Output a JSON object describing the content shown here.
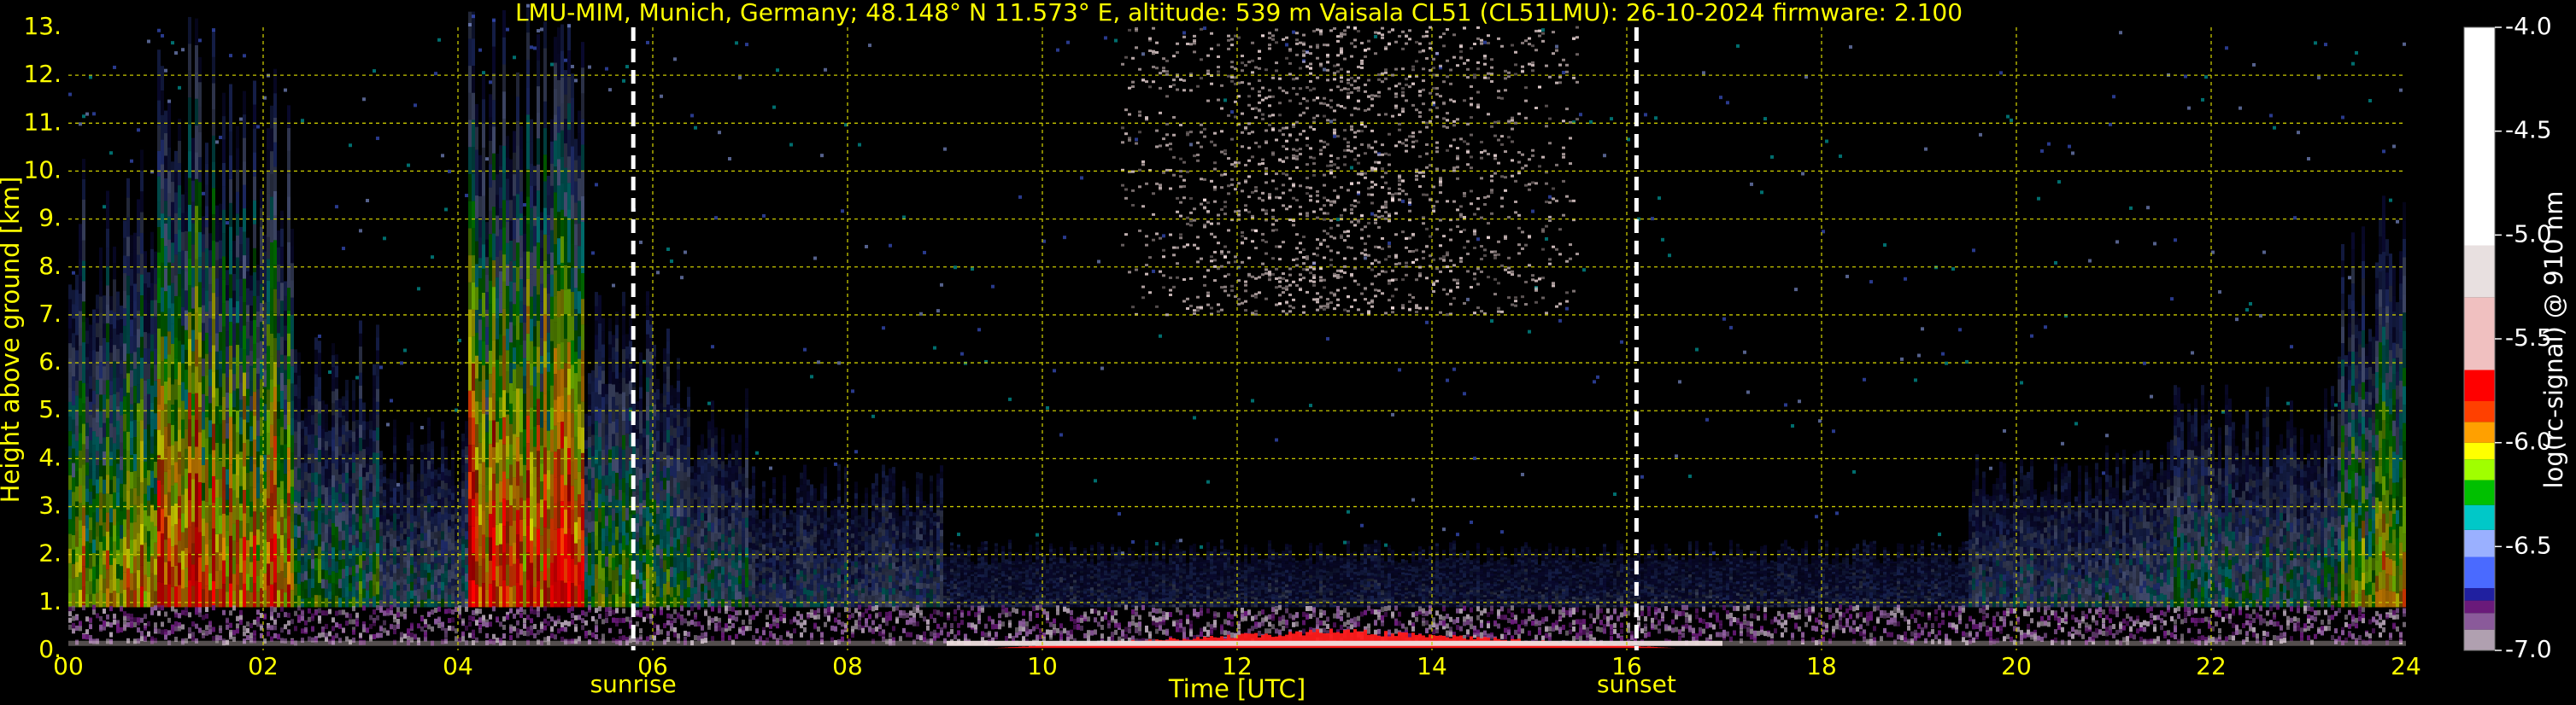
{
  "chart_data": {
    "type": "heatmap",
    "title": "LMU-MIM, Munich, Germany; 48.148° N 11.573° E, altitude: 539 m    Vaisala CL51 (CL51LMU): 26-10-2024    firmware: 2.100",
    "xlabel": "Time [UTC]",
    "ylabel": "Height above ground [km]",
    "xlim": [
      0,
      24
    ],
    "ylim": [
      0,
      13
    ],
    "x_ticks": [
      "00",
      "02",
      "04",
      "06",
      "08",
      "10",
      "12",
      "14",
      "16",
      "18",
      "20",
      "22",
      "24"
    ],
    "y_ticks": [
      "0.",
      "1.",
      "2.",
      "3.",
      "4.",
      "5.",
      "6.",
      "7.",
      "8.",
      "9.",
      "10.",
      "11.",
      "12.",
      "13."
    ],
    "grid": true,
    "annotations": [
      {
        "label": "sunrise",
        "x": 5.8
      },
      {
        "label": "sunset",
        "x": 16.1
      }
    ],
    "colorbar": {
      "label": "log(rc-signal) @ 910 nm",
      "range": [
        -7.0,
        -4.0
      ],
      "ticks": [
        "-4.0",
        "-4.5",
        "-5.0",
        "-5.5",
        "-6.0",
        "-6.5",
        "-7.0"
      ]
    },
    "aerosol_layer": [
      {
        "t_start": 0.0,
        "t_end": 0.9,
        "intensity": 0.72
      },
      {
        "t_start": 0.9,
        "t_end": 1.6,
        "intensity": 0.95
      },
      {
        "t_start": 1.6,
        "t_end": 2.3,
        "intensity": 0.85
      },
      {
        "t_start": 2.3,
        "t_end": 3.2,
        "intensity": 0.45
      },
      {
        "t_start": 3.2,
        "t_end": 4.1,
        "intensity": 0.3
      },
      {
        "t_start": 4.1,
        "t_end": 5.3,
        "intensity": 0.95
      },
      {
        "t_start": 5.3,
        "t_end": 6.3,
        "intensity": 0.5
      },
      {
        "t_start": 6.3,
        "t_end": 7.0,
        "intensity": 0.35
      },
      {
        "t_start": 7.0,
        "t_end": 9.0,
        "intensity": 0.22
      },
      {
        "t_start": 9.0,
        "t_end": 19.5,
        "intensity": 0.1
      },
      {
        "t_start": 19.5,
        "t_end": 21.5,
        "intensity": 0.25
      },
      {
        "t_start": 21.5,
        "t_end": 23.3,
        "intensity": 0.35
      },
      {
        "t_start": 23.3,
        "t_end": 24.0,
        "intensity": 0.65
      }
    ]
  },
  "colors": {
    "background": "#000000",
    "axis_text": "#ffff00",
    "grid": "#c8c800",
    "marker": "#ffffff",
    "colorbar_scale": [
      "#b0a0b0",
      "#8a5a9a",
      "#6a1a7a",
      "#2020a0",
      "#4a6aff",
      "#9ab0ff",
      "#00c8c8",
      "#00c000",
      "#a0ff00",
      "#ffff00",
      "#ffa000",
      "#ff4000",
      "#ff0000",
      "#f0c0c0",
      "#ffffff"
    ]
  }
}
